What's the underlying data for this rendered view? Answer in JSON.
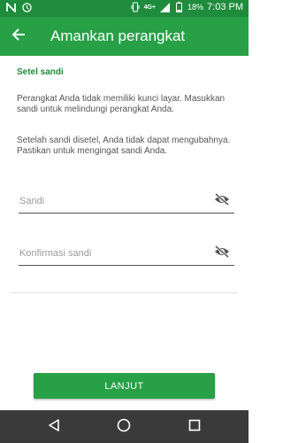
{
  "status_bar": {
    "time": "7:03 PM",
    "battery": "18%",
    "network": "4G+",
    "icons": [
      "n-icon",
      "clock-icon",
      "vibrate-icon",
      "signal-icon",
      "battery-icon"
    ]
  },
  "app_bar": {
    "title": "Amankan perangkat",
    "back_icon": "arrow-left-icon",
    "color": "#27a046"
  },
  "main": {
    "section_title": "Setel sandi",
    "paragraph1": "Perangkat Anda tidak memiliki kunci layar. Masukkan sandi untuk melindungi perangkat Anda.",
    "paragraph2": " Setelah sandi disetel, Anda tidak dapat mengubahnya. Pastikan untuk mengingat sandi Anda.",
    "password_field": {
      "placeholder": "Sandi",
      "value": ""
    },
    "confirm_field": {
      "placeholder": "Konfirmasi sandi",
      "value": ""
    },
    "visibility_icon": "eye-off-icon"
  },
  "footer": {
    "continue_label": "LANJUT"
  },
  "nav_bar": {
    "icons": [
      "back-triangle-icon",
      "home-circle-icon",
      "recents-square-icon"
    ]
  }
}
